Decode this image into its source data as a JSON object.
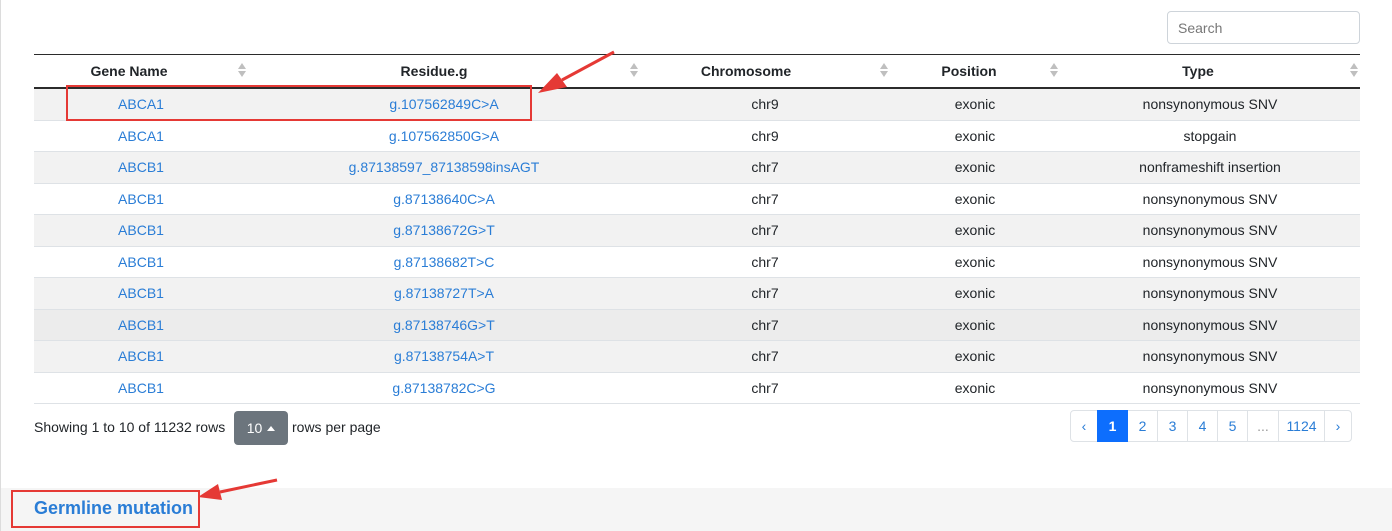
{
  "search": {
    "placeholder": "Search"
  },
  "table": {
    "columns": [
      "Gene Name",
      "Residue.g",
      "Chromosome",
      "Position",
      "Type"
    ],
    "rows": [
      {
        "gene": "ABCA1",
        "residue": "g.107562849C>A",
        "chromosome": "chr9",
        "position": "exonic",
        "type": "nonsynonymous SNV"
      },
      {
        "gene": "ABCA1",
        "residue": "g.107562850G>A",
        "chromosome": "chr9",
        "position": "exonic",
        "type": "stopgain"
      },
      {
        "gene": "ABCB1",
        "residue": "g.87138597_87138598insAGT",
        "chromosome": "chr7",
        "position": "exonic",
        "type": "nonframeshift insertion"
      },
      {
        "gene": "ABCB1",
        "residue": "g.87138640C>A",
        "chromosome": "chr7",
        "position": "exonic",
        "type": "nonsynonymous SNV"
      },
      {
        "gene": "ABCB1",
        "residue": "g.87138672G>T",
        "chromosome": "chr7",
        "position": "exonic",
        "type": "nonsynonymous SNV"
      },
      {
        "gene": "ABCB1",
        "residue": "g.87138682T>C",
        "chromosome": "chr7",
        "position": "exonic",
        "type": "nonsynonymous SNV"
      },
      {
        "gene": "ABCB1",
        "residue": "g.87138727T>A",
        "chromosome": "chr7",
        "position": "exonic",
        "type": "nonsynonymous SNV"
      },
      {
        "gene": "ABCB1",
        "residue": "g.87138746G>T",
        "chromosome": "chr7",
        "position": "exonic",
        "type": "nonsynonymous SNV"
      },
      {
        "gene": "ABCB1",
        "residue": "g.87138754A>T",
        "chromosome": "chr7",
        "position": "exonic",
        "type": "nonsynonymous SNV"
      },
      {
        "gene": "ABCB1",
        "residue": "g.87138782C>G",
        "chromosome": "chr7",
        "position": "exonic",
        "type": "nonsynonymous SNV"
      }
    ]
  },
  "footer": {
    "showing_text": "Showing 1 to 10 of 11232 rows",
    "page_size": "10",
    "rows_per_page": "rows per page"
  },
  "pagination": {
    "prev": "‹",
    "pages": [
      "1",
      "2",
      "3",
      "4",
      "5",
      "...",
      "1124"
    ],
    "next": "›",
    "active": "1"
  },
  "section": {
    "title": "Germline mutation"
  },
  "colors": {
    "link": "#2a7dd6",
    "active_page": "#0d6efd",
    "highlight": "#e53935"
  }
}
